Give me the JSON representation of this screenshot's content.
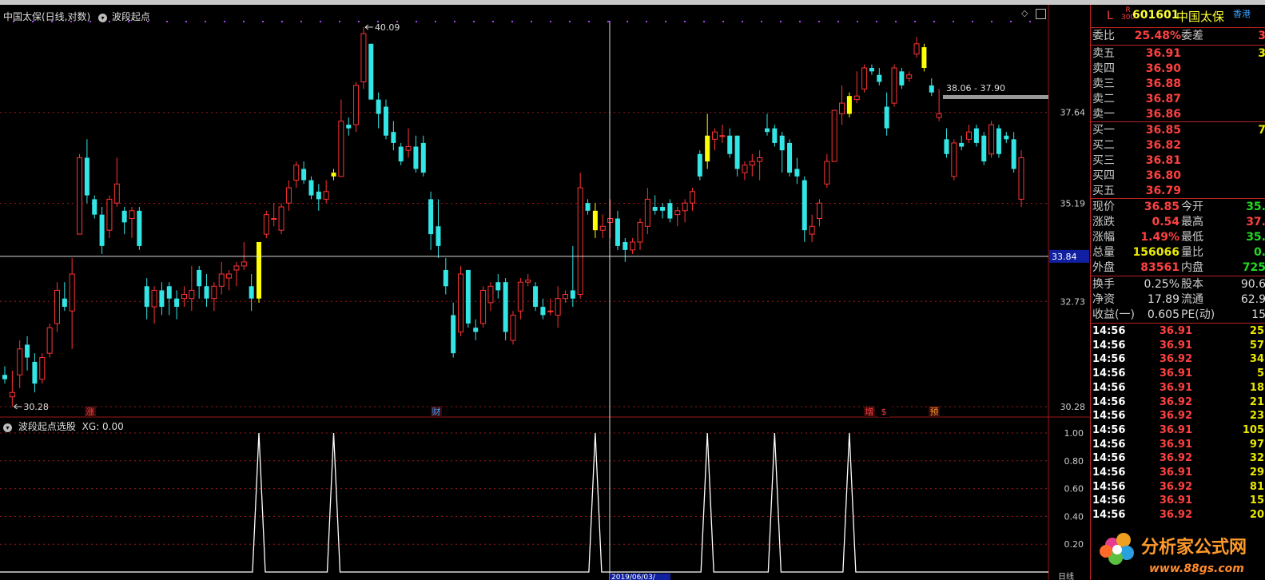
{
  "header": {
    "title": "中国太保(日线,对数)",
    "indicator": "波段起点",
    "sub_title": "波段起点选股",
    "sub_value": "XG: 0.00"
  },
  "price_axis": {
    "ticks": [
      "37.64",
      "35.19",
      "32.73",
      "30.28"
    ],
    "current": "33.84"
  },
  "indicator_axis": {
    "ticks": [
      "1.00",
      "0.80",
      "0.60",
      "0.40",
      "0.20"
    ]
  },
  "annotations": {
    "high": "40.09",
    "low": "30.28",
    "range": "38.06 - 37.90"
  },
  "markers": [
    "涨",
    "财",
    "增",
    "$",
    "预"
  ],
  "bottom": {
    "date": "2019/06/03/",
    "period": "日线"
  },
  "colors": {
    "up": "#ff3333",
    "down": "#33e5e5",
    "signal": "#ffff00",
    "grid": "#a01818"
  },
  "quote": {
    "mark": "L",
    "mark2": "R\n300",
    "code": "601601",
    "name": "中国太保",
    "hk": "香港",
    "weibi_label": "委比",
    "weibi": "25.48%",
    "weicha_label": "委差",
    "weicha": "3",
    "asks": [
      {
        "label": "卖五",
        "price": "36.91",
        "vol": "3"
      },
      {
        "label": "卖四",
        "price": "36.90",
        "vol": ""
      },
      {
        "label": "卖三",
        "price": "36.88",
        "vol": ""
      },
      {
        "label": "卖二",
        "price": "36.87",
        "vol": ""
      },
      {
        "label": "卖一",
        "price": "36.86",
        "vol": ""
      }
    ],
    "bids": [
      {
        "label": "买一",
        "price": "36.85",
        "vol": "7"
      },
      {
        "label": "买二",
        "price": "36.82",
        "vol": ""
      },
      {
        "label": "买三",
        "price": "36.81",
        "vol": ""
      },
      {
        "label": "买四",
        "price": "36.80",
        "vol": ""
      },
      {
        "label": "买五",
        "price": "36.79",
        "vol": ""
      }
    ],
    "stats": [
      {
        "l1": "现价",
        "v1": "36.85",
        "l2": "今开",
        "v2": "35."
      },
      {
        "l1": "涨跌",
        "v1": "0.54",
        "l2": "最高",
        "v2": "37."
      },
      {
        "l1": "涨幅",
        "v1": "1.49%",
        "l2": "最低",
        "v2": "35."
      },
      {
        "l1": "总量",
        "v1": "156066",
        "l2": "量比",
        "v2": "0."
      },
      {
        "l1": "外盘",
        "v1": "83561",
        "l2": "内盘",
        "v2": "725"
      }
    ],
    "stats2": [
      {
        "l1": "换手",
        "v1": "0.25%",
        "l2": "股本",
        "v2": "90.6"
      },
      {
        "l1": "净资",
        "v1": "17.89",
        "l2": "流通",
        "v2": "62.9"
      },
      {
        "l1": "收益(一)",
        "v1": "0.605",
        "l2": "PE(动)",
        "v2": "15"
      }
    ],
    "ticks": [
      {
        "t": "14:56",
        "p": "36.91",
        "v": "25"
      },
      {
        "t": "14:56",
        "p": "36.91",
        "v": "57"
      },
      {
        "t": "14:56",
        "p": "36.92",
        "v": "34"
      },
      {
        "t": "14:56",
        "p": "36.91",
        "v": "5"
      },
      {
        "t": "14:56",
        "p": "36.91",
        "v": "18"
      },
      {
        "t": "14:56",
        "p": "36.92",
        "v": "21"
      },
      {
        "t": "14:56",
        "p": "36.92",
        "v": "23"
      },
      {
        "t": "14:56",
        "p": "36.91",
        "v": "105"
      },
      {
        "t": "14:56",
        "p": "36.91",
        "v": "97"
      },
      {
        "t": "14:56",
        "p": "36.92",
        "v": "32"
      },
      {
        "t": "14:56",
        "p": "36.91",
        "v": "29"
      },
      {
        "t": "14:56",
        "p": "36.92",
        "v": "81"
      },
      {
        "t": "14:56",
        "p": "36.91",
        "v": "15"
      },
      {
        "t": "14:56",
        "p": "36.92",
        "v": "20"
      }
    ]
  },
  "watermark": {
    "brand": "分析家公式网",
    "url": "www.88gs.com"
  },
  "chart_data": {
    "type": "candlestick",
    "title": "中国太保(日线,对数)",
    "price_ticks": [
      37.64,
      35.19,
      32.73,
      30.28
    ],
    "candles": [
      {
        "o": 31.0,
        "h": 31.2,
        "l": 30.8,
        "c": 30.9
      },
      {
        "o": 30.5,
        "h": 31.1,
        "l": 30.28,
        "c": 30.6
      },
      {
        "o": 31.0,
        "h": 31.8,
        "l": 30.7,
        "c": 31.6
      },
      {
        "o": 31.7,
        "h": 31.9,
        "l": 31.1,
        "c": 31.4
      },
      {
        "o": 31.3,
        "h": 31.5,
        "l": 30.6,
        "c": 30.8
      },
      {
        "o": 30.9,
        "h": 31.5,
        "l": 30.8,
        "c": 31.4
      },
      {
        "o": 31.5,
        "h": 32.2,
        "l": 31.4,
        "c": 32.1
      },
      {
        "o": 32.2,
        "h": 33.2,
        "l": 32.0,
        "c": 33.0
      },
      {
        "o": 32.8,
        "h": 33.2,
        "l": 32.5,
        "c": 32.6
      },
      {
        "o": 32.5,
        "h": 33.8,
        "l": 31.6,
        "c": 33.4
      },
      {
        "o": 34.4,
        "h": 36.5,
        "l": 34.4,
        "c": 36.4
      },
      {
        "o": 36.4,
        "h": 36.9,
        "l": 35.2,
        "c": 35.4
      },
      {
        "o": 35.3,
        "h": 35.4,
        "l": 34.8,
        "c": 34.9
      },
      {
        "o": 34.9,
        "h": 35.1,
        "l": 33.9,
        "c": 34.1
      },
      {
        "o": 34.5,
        "h": 35.4,
        "l": 34.3,
        "c": 35.3
      },
      {
        "o": 35.2,
        "h": 36.4,
        "l": 35.1,
        "c": 35.7
      },
      {
        "o": 35.0,
        "h": 35.1,
        "l": 34.4,
        "c": 34.7
      },
      {
        "o": 34.8,
        "h": 35.1,
        "l": 34.3,
        "c": 35.0
      },
      {
        "o": 35.0,
        "h": 35.1,
        "l": 34.0,
        "c": 34.1
      },
      {
        "o": 33.1,
        "h": 33.3,
        "l": 32.3,
        "c": 32.6
      },
      {
        "o": 32.6,
        "h": 33.1,
        "l": 32.2,
        "c": 33.0
      },
      {
        "o": 33.0,
        "h": 33.2,
        "l": 32.4,
        "c": 32.6
      },
      {
        "o": 33.1,
        "h": 33.2,
        "l": 32.4,
        "c": 32.8
      },
      {
        "o": 32.8,
        "h": 33.0,
        "l": 32.3,
        "c": 32.6
      },
      {
        "o": 32.8,
        "h": 33.1,
        "l": 32.6,
        "c": 32.9
      },
      {
        "o": 32.8,
        "h": 33.6,
        "l": 32.5,
        "c": 33.0
      },
      {
        "o": 33.5,
        "h": 33.6,
        "l": 32.8,
        "c": 33.1
      },
      {
        "o": 33.1,
        "h": 33.4,
        "l": 32.6,
        "c": 32.8
      },
      {
        "o": 32.8,
        "h": 33.2,
        "l": 32.5,
        "c": 33.1
      },
      {
        "o": 33.1,
        "h": 33.7,
        "l": 32.9,
        "c": 33.4
      },
      {
        "o": 33.3,
        "h": 33.5,
        "l": 33.0,
        "c": 33.4
      },
      {
        "o": 33.5,
        "h": 33.7,
        "l": 33.1,
        "c": 33.6
      },
      {
        "o": 33.6,
        "h": 34.2,
        "l": 33.5,
        "c": 33.7
      },
      {
        "o": 33.1,
        "h": 33.4,
        "l": 32.5,
        "c": 32.8
      },
      {
        "o": 32.8,
        "h": 34.2,
        "l": 32.7,
        "c": 34.2
      },
      {
        "o": 34.4,
        "h": 35.0,
        "l": 34.3,
        "c": 34.9
      },
      {
        "o": 34.8,
        "h": 35.2,
        "l": 34.6,
        "c": 34.8
      },
      {
        "o": 34.5,
        "h": 35.2,
        "l": 34.4,
        "c": 35.1
      },
      {
        "o": 35.2,
        "h": 35.8,
        "l": 35.0,
        "c": 35.6
      },
      {
        "o": 35.8,
        "h": 36.3,
        "l": 35.6,
        "c": 36.2
      },
      {
        "o": 36.1,
        "h": 36.3,
        "l": 35.7,
        "c": 35.8
      },
      {
        "o": 35.8,
        "h": 35.9,
        "l": 35.3,
        "c": 35.4
      },
      {
        "o": 35.5,
        "h": 35.7,
        "l": 35.0,
        "c": 35.3
      },
      {
        "o": 35.3,
        "h": 35.8,
        "l": 35.2,
        "c": 35.5
      },
      {
        "o": 36.0,
        "h": 36.1,
        "l": 35.8,
        "c": 35.9
      },
      {
        "o": 35.9,
        "h": 38.0,
        "l": 35.9,
        "c": 37.4
      },
      {
        "o": 37.3,
        "h": 37.5,
        "l": 37.0,
        "c": 37.2
      },
      {
        "o": 37.3,
        "h": 38.5,
        "l": 37.1,
        "c": 38.4
      },
      {
        "o": 38.5,
        "h": 40.09,
        "l": 38.3,
        "c": 39.9
      },
      {
        "o": 39.6,
        "h": 39.6,
        "l": 38.0,
        "c": 38.0
      },
      {
        "o": 38.0,
        "h": 38.2,
        "l": 37.2,
        "c": 37.6
      },
      {
        "o": 37.8,
        "h": 38.0,
        "l": 36.9,
        "c": 37.0
      },
      {
        "o": 37.1,
        "h": 37.4,
        "l": 36.6,
        "c": 36.8
      },
      {
        "o": 36.7,
        "h": 36.8,
        "l": 36.2,
        "c": 36.3
      },
      {
        "o": 36.6,
        "h": 37.2,
        "l": 36.4,
        "c": 36.7
      },
      {
        "o": 36.7,
        "h": 37.0,
        "l": 36.0,
        "c": 36.1
      },
      {
        "o": 36.8,
        "h": 37.0,
        "l": 35.9,
        "c": 36.0
      },
      {
        "o": 35.3,
        "h": 35.5,
        "l": 34.0,
        "c": 34.4
      },
      {
        "o": 34.6,
        "h": 35.3,
        "l": 33.8,
        "c": 34.1
      },
      {
        "o": 33.5,
        "h": 33.8,
        "l": 32.9,
        "c": 33.1
      },
      {
        "o": 32.4,
        "h": 32.7,
        "l": 31.4,
        "c": 31.5
      },
      {
        "o": 32.0,
        "h": 33.6,
        "l": 31.9,
        "c": 33.4
      },
      {
        "o": 33.5,
        "h": 33.5,
        "l": 32.1,
        "c": 32.2
      },
      {
        "o": 32.1,
        "h": 32.3,
        "l": 31.8,
        "c": 32.0
      },
      {
        "o": 32.2,
        "h": 33.1,
        "l": 32.1,
        "c": 33.0
      },
      {
        "o": 32.7,
        "h": 33.2,
        "l": 32.5,
        "c": 33.1
      },
      {
        "o": 33.2,
        "h": 33.4,
        "l": 32.8,
        "c": 33.0
      },
      {
        "o": 33.2,
        "h": 33.3,
        "l": 31.8,
        "c": 32.0
      },
      {
        "o": 31.8,
        "h": 32.5,
        "l": 31.7,
        "c": 32.4
      },
      {
        "o": 32.5,
        "h": 33.3,
        "l": 32.3,
        "c": 33.2
      },
      {
        "o": 33.2,
        "h": 33.4,
        "l": 33.1,
        "c": 33.25
      },
      {
        "o": 33.1,
        "h": 33.2,
        "l": 32.5,
        "c": 32.6
      },
      {
        "o": 32.6,
        "h": 32.8,
        "l": 32.3,
        "c": 32.4
      },
      {
        "o": 32.5,
        "h": 32.8,
        "l": 32.4,
        "c": 32.5
      },
      {
        "o": 32.4,
        "h": 33.1,
        "l": 32.1,
        "c": 32.8
      },
      {
        "o": 32.8,
        "h": 33.0,
        "l": 32.7,
        "c": 32.9
      },
      {
        "o": 33.0,
        "h": 34.1,
        "l": 32.6,
        "c": 32.8
      },
      {
        "o": 32.9,
        "h": 36.0,
        "l": 32.8,
        "c": 35.6
      },
      {
        "o": 35.2,
        "h": 35.3,
        "l": 34.9,
        "c": 35.0
      },
      {
        "o": 35.0,
        "h": 35.2,
        "l": 34.3,
        "c": 34.5
      },
      {
        "o": 34.5,
        "h": 34.9,
        "l": 34.3,
        "c": 34.6
      },
      {
        "o": 34.7,
        "h": 35.3,
        "l": 34.3,
        "c": 34.8
      },
      {
        "o": 34.8,
        "h": 35.0,
        "l": 34.0,
        "c": 34.1
      },
      {
        "o": 34.2,
        "h": 34.3,
        "l": 33.7,
        "c": 34.0
      },
      {
        "o": 34.0,
        "h": 34.3,
        "l": 33.9,
        "c": 34.2
      },
      {
        "o": 34.2,
        "h": 34.8,
        "l": 34.0,
        "c": 34.7
      },
      {
        "o": 34.6,
        "h": 35.6,
        "l": 34.4,
        "c": 35.3
      },
      {
        "o": 35.1,
        "h": 35.4,
        "l": 34.9,
        "c": 35.0
      },
      {
        "o": 35.1,
        "h": 35.2,
        "l": 34.8,
        "c": 35.0
      },
      {
        "o": 35.2,
        "h": 35.3,
        "l": 34.7,
        "c": 34.8
      },
      {
        "o": 34.9,
        "h": 35.1,
        "l": 34.6,
        "c": 35.0
      },
      {
        "o": 35.0,
        "h": 35.3,
        "l": 34.7,
        "c": 35.2
      },
      {
        "o": 35.2,
        "h": 35.6,
        "l": 35.0,
        "c": 35.5
      },
      {
        "o": 36.5,
        "h": 36.6,
        "l": 35.8,
        "c": 35.9
      },
      {
        "o": 36.3,
        "h": 37.6,
        "l": 36.1,
        "c": 37.0
      },
      {
        "o": 36.9,
        "h": 37.2,
        "l": 36.6,
        "c": 37.1
      },
      {
        "o": 37.0,
        "h": 37.3,
        "l": 36.8,
        "c": 37.0
      },
      {
        "o": 37.0,
        "h": 37.2,
        "l": 36.4,
        "c": 36.5
      },
      {
        "o": 37.0,
        "h": 37.0,
        "l": 35.9,
        "c": 36.1
      },
      {
        "o": 36.0,
        "h": 36.3,
        "l": 35.8,
        "c": 36.2
      },
      {
        "o": 36.2,
        "h": 36.5,
        "l": 35.9,
        "c": 36.3
      },
      {
        "o": 36.3,
        "h": 36.6,
        "l": 35.8,
        "c": 36.4
      },
      {
        "o": 37.2,
        "h": 37.6,
        "l": 37.0,
        "c": 37.1
      },
      {
        "o": 37.2,
        "h": 37.3,
        "l": 36.7,
        "c": 36.8
      },
      {
        "o": 37.0,
        "h": 37.1,
        "l": 36.0,
        "c": 36.6
      },
      {
        "o": 36.8,
        "h": 36.9,
        "l": 35.9,
        "c": 36.0
      },
      {
        "o": 36.1,
        "h": 36.4,
        "l": 35.7,
        "c": 35.9
      },
      {
        "o": 35.8,
        "h": 35.9,
        "l": 34.2,
        "c": 34.5
      },
      {
        "o": 34.4,
        "h": 34.9,
        "l": 34.2,
        "c": 34.6
      },
      {
        "o": 34.8,
        "h": 35.3,
        "l": 34.6,
        "c": 35.2
      },
      {
        "o": 35.7,
        "h": 36.5,
        "l": 35.6,
        "c": 36.3
      },
      {
        "o": 36.3,
        "h": 37.7,
        "l": 36.3,
        "c": 37.7
      },
      {
        "o": 37.6,
        "h": 38.4,
        "l": 37.3,
        "c": 37.9
      },
      {
        "o": 37.6,
        "h": 38.2,
        "l": 37.5,
        "c": 38.1
      },
      {
        "o": 38.0,
        "h": 38.8,
        "l": 37.9,
        "c": 38.1
      },
      {
        "o": 38.3,
        "h": 39.0,
        "l": 38.2,
        "c": 38.9
      },
      {
        "o": 38.9,
        "h": 39.0,
        "l": 38.7,
        "c": 38.8
      },
      {
        "o": 38.7,
        "h": 38.9,
        "l": 38.4,
        "c": 38.5
      },
      {
        "o": 37.8,
        "h": 38.2,
        "l": 37.0,
        "c": 37.2
      },
      {
        "o": 37.9,
        "h": 39.0,
        "l": 37.8,
        "c": 38.9
      },
      {
        "o": 38.8,
        "h": 38.9,
        "l": 38.3,
        "c": 38.4
      },
      {
        "o": 38.6,
        "h": 38.8,
        "l": 38.5,
        "c": 38.7
      },
      {
        "o": 39.3,
        "h": 39.8,
        "l": 39.2,
        "c": 39.6
      },
      {
        "o": 39.5,
        "h": 39.6,
        "l": 38.8,
        "c": 38.9
      },
      {
        "o": 38.4,
        "h": 38.6,
        "l": 38.1,
        "c": 38.2
      },
      {
        "o": 37.5,
        "h": 38.3,
        "l": 37.4,
        "c": 37.6
      },
      {
        "o": 36.9,
        "h": 37.2,
        "l": 36.4,
        "c": 36.5
      },
      {
        "o": 35.9,
        "h": 36.9,
        "l": 35.8,
        "c": 36.8
      },
      {
        "o": 36.8,
        "h": 37.0,
        "l": 36.6,
        "c": 36.7
      },
      {
        "o": 36.9,
        "h": 37.3,
        "l": 36.8,
        "c": 37.1
      },
      {
        "o": 37.2,
        "h": 37.3,
        "l": 36.7,
        "c": 36.8
      },
      {
        "o": 37.0,
        "h": 37.1,
        "l": 36.2,
        "c": 36.3
      },
      {
        "o": 36.5,
        "h": 37.4,
        "l": 36.4,
        "c": 37.3
      },
      {
        "o": 37.2,
        "h": 37.3,
        "l": 36.4,
        "c": 36.5
      },
      {
        "o": 37.0,
        "h": 37.1,
        "l": 36.8,
        "c": 36.9
      },
      {
        "o": 36.9,
        "h": 37.1,
        "l": 36.0,
        "c": 36.1
      },
      {
        "o": 35.3,
        "h": 36.6,
        "l": 35.1,
        "c": 36.4
      }
    ],
    "signal_indices": [
      34,
      44,
      79,
      94,
      113,
      123
    ],
    "indicator": {
      "name": "XG",
      "value": 0.0,
      "spikes": [
        34,
        44,
        79,
        94,
        103,
        113
      ]
    }
  }
}
